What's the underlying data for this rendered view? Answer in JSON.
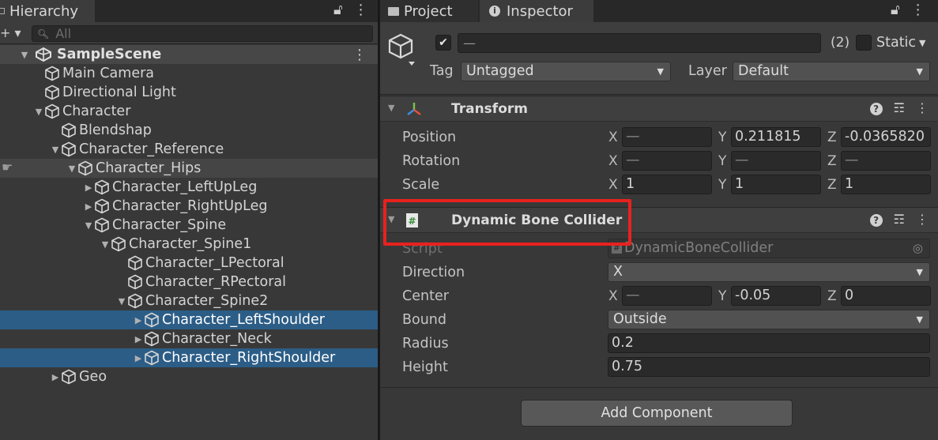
{
  "hierarchy": {
    "tab_label": "Hierarchy",
    "search_placeholder": "All",
    "scene_name": "SampleScene",
    "nodes": [
      {
        "label": "Main Camera"
      },
      {
        "label": "Directional Light"
      },
      {
        "label": "Character"
      },
      {
        "label": "Blendshap"
      },
      {
        "label": "Character_Reference"
      },
      {
        "label": "Character_Hips"
      },
      {
        "label": "Character_LeftUpLeg"
      },
      {
        "label": "Character_RightUpLeg"
      },
      {
        "label": "Character_Spine"
      },
      {
        "label": "Character_Spine1"
      },
      {
        "label": "Character_LPectoral"
      },
      {
        "label": "Character_RPectoral"
      },
      {
        "label": "Character_Spine2"
      },
      {
        "label": "Character_LeftShoulder"
      },
      {
        "label": "Character_Neck"
      },
      {
        "label": "Character_RightShoulder"
      },
      {
        "label": "Geo"
      }
    ]
  },
  "inspector": {
    "tabs": {
      "project": "Project",
      "inspector": "Inspector"
    },
    "object": {
      "active_check": "✔",
      "name_value": "—",
      "selection_count": "(2)",
      "static_label": "Static",
      "tag_label": "Tag",
      "tag_value": "Untagged",
      "layer_label": "Layer",
      "layer_value": "Default"
    },
    "transform": {
      "title": "Transform",
      "position_label": "Position",
      "rotation_label": "Rotation",
      "scale_label": "Scale",
      "position": {
        "x": "—",
        "y": "0.211815",
        "z": "-0.0365820"
      },
      "rotation": {
        "x": "—",
        "y": "—",
        "z": "—"
      },
      "scale": {
        "x": "1",
        "y": "1",
        "z": "1"
      }
    },
    "collider": {
      "title": "Dynamic Bone Collider",
      "script_label": "Script",
      "script_value": "DynamicBoneCollider",
      "direction_label": "Direction",
      "direction_value": "X",
      "center_label": "Center",
      "center": {
        "x": "—",
        "y": "-0.05",
        "z": "0"
      },
      "bound_label": "Bound",
      "bound_value": "Outside",
      "radius_label": "Radius",
      "radius_value": "0.2",
      "height_label": "Height",
      "height_value": "0.75"
    },
    "add_component_label": "Add Component",
    "axis_labels": {
      "x": "X",
      "y": "Y",
      "z": "Z"
    }
  },
  "colors": {
    "selection": "#2c5d87",
    "highlight_box": "#e8221e",
    "panel_bg": "#383838"
  }
}
